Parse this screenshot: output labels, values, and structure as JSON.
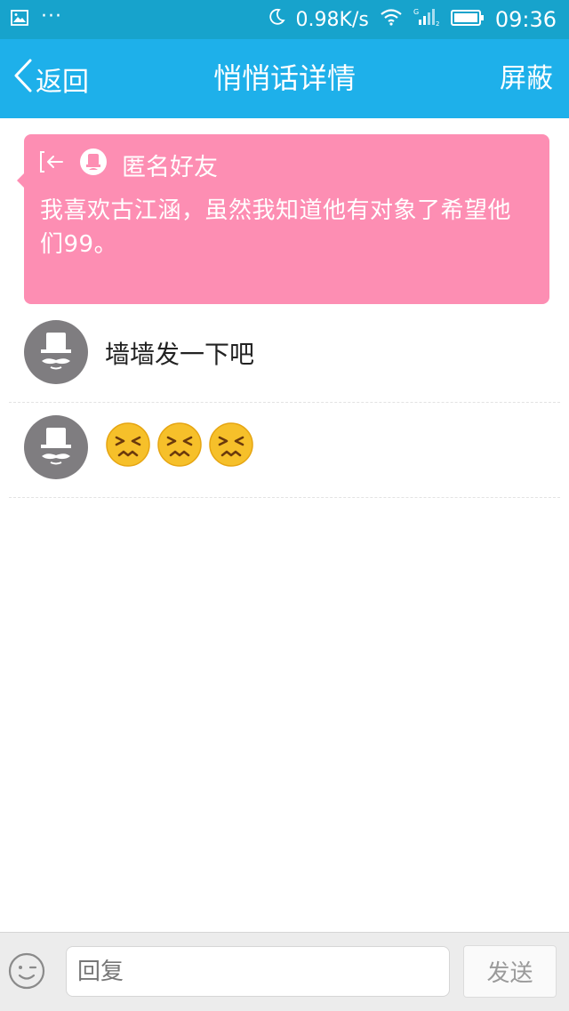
{
  "status_bar": {
    "dots": "···",
    "network_speed": "0.98K/s",
    "time": "09:36",
    "icons": [
      "image-icon",
      "moon-icon",
      "wifi-icon",
      "signal-icon",
      "battery-icon"
    ]
  },
  "nav": {
    "back_label": "返回",
    "title": "悄悄话详情",
    "right_label": "屏蔽",
    "bar_color": "#1eb0ea"
  },
  "whisper": {
    "sender": "匿名好友",
    "text": "我喜欢古江涵，虽然我知道他有对象了希望他们99。",
    "card_color": "#fd8eb3",
    "icons": [
      "exit-arrow-icon",
      "anonymous-badge-icon"
    ]
  },
  "comments": [
    {
      "avatar": "anonymous-gentleman-avatar",
      "text": "墙墙发一下吧"
    },
    {
      "avatar": "anonymous-gentleman-avatar",
      "text": "",
      "emojis": [
        "persevering-face",
        "persevering-face",
        "persevering-face"
      ]
    }
  ],
  "composer": {
    "placeholder": "回复",
    "send_label": "发送",
    "emoji_button_icon": "wink-face-icon"
  }
}
